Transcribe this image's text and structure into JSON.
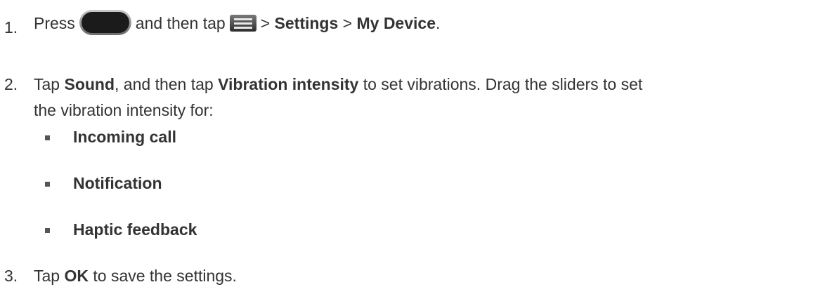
{
  "steps": [
    {
      "number": "1.",
      "press": "Press",
      "and_then_tap": "and then tap",
      "sep1": ">",
      "settings": "Settings",
      "sep2": ">",
      "my_device": "My Device",
      "end": "."
    },
    {
      "number": "2.",
      "tap": "Tap",
      "sound": "Sound",
      "mid": ", and then tap",
      "vibration_intensity": "Vibration intensity",
      "rest_line1": "to set vibrations. Drag the sliders to set",
      "line2": "the vibration intensity for:"
    },
    {
      "number": "3.",
      "tap": "Tap",
      "ok": "OK",
      "rest": "to save the settings."
    }
  ],
  "bullets": [
    "Incoming call",
    "Notification",
    "Haptic feedback"
  ],
  "icons": {
    "home_key": "home-key-icon",
    "menu": "menu-icon"
  }
}
